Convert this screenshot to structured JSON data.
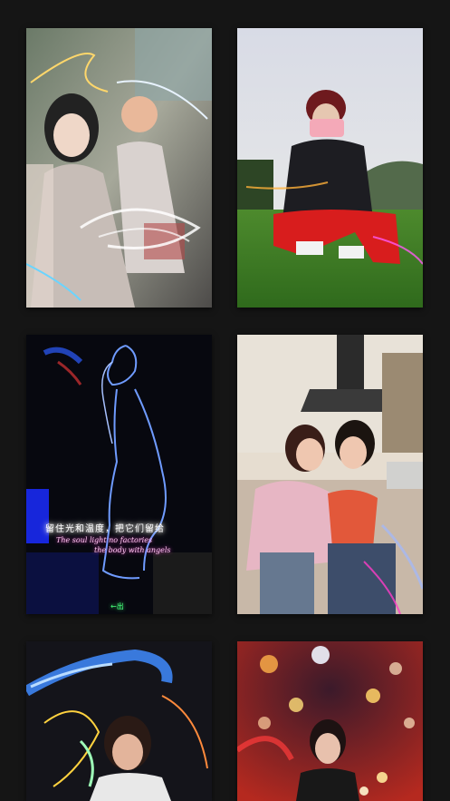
{
  "photos": [
    {
      "id": "photo-1",
      "caption": ""
    },
    {
      "id": "photo-2",
      "caption": ""
    },
    {
      "id": "photo-3",
      "caption": ""
    },
    {
      "id": "photo-4",
      "caption": ""
    },
    {
      "id": "photo-5",
      "caption": ""
    },
    {
      "id": "photo-6",
      "caption": ""
    }
  ],
  "neon_photo": {
    "cn_text": "留住光和温度，把它们留给",
    "line1": "The soul light no factories",
    "line2": "the body with angels",
    "exit_sign": "←出"
  },
  "colors": {
    "background": "#151515",
    "neon_blue": "#6f9bff",
    "neon_pink": "#ff4fd6"
  }
}
